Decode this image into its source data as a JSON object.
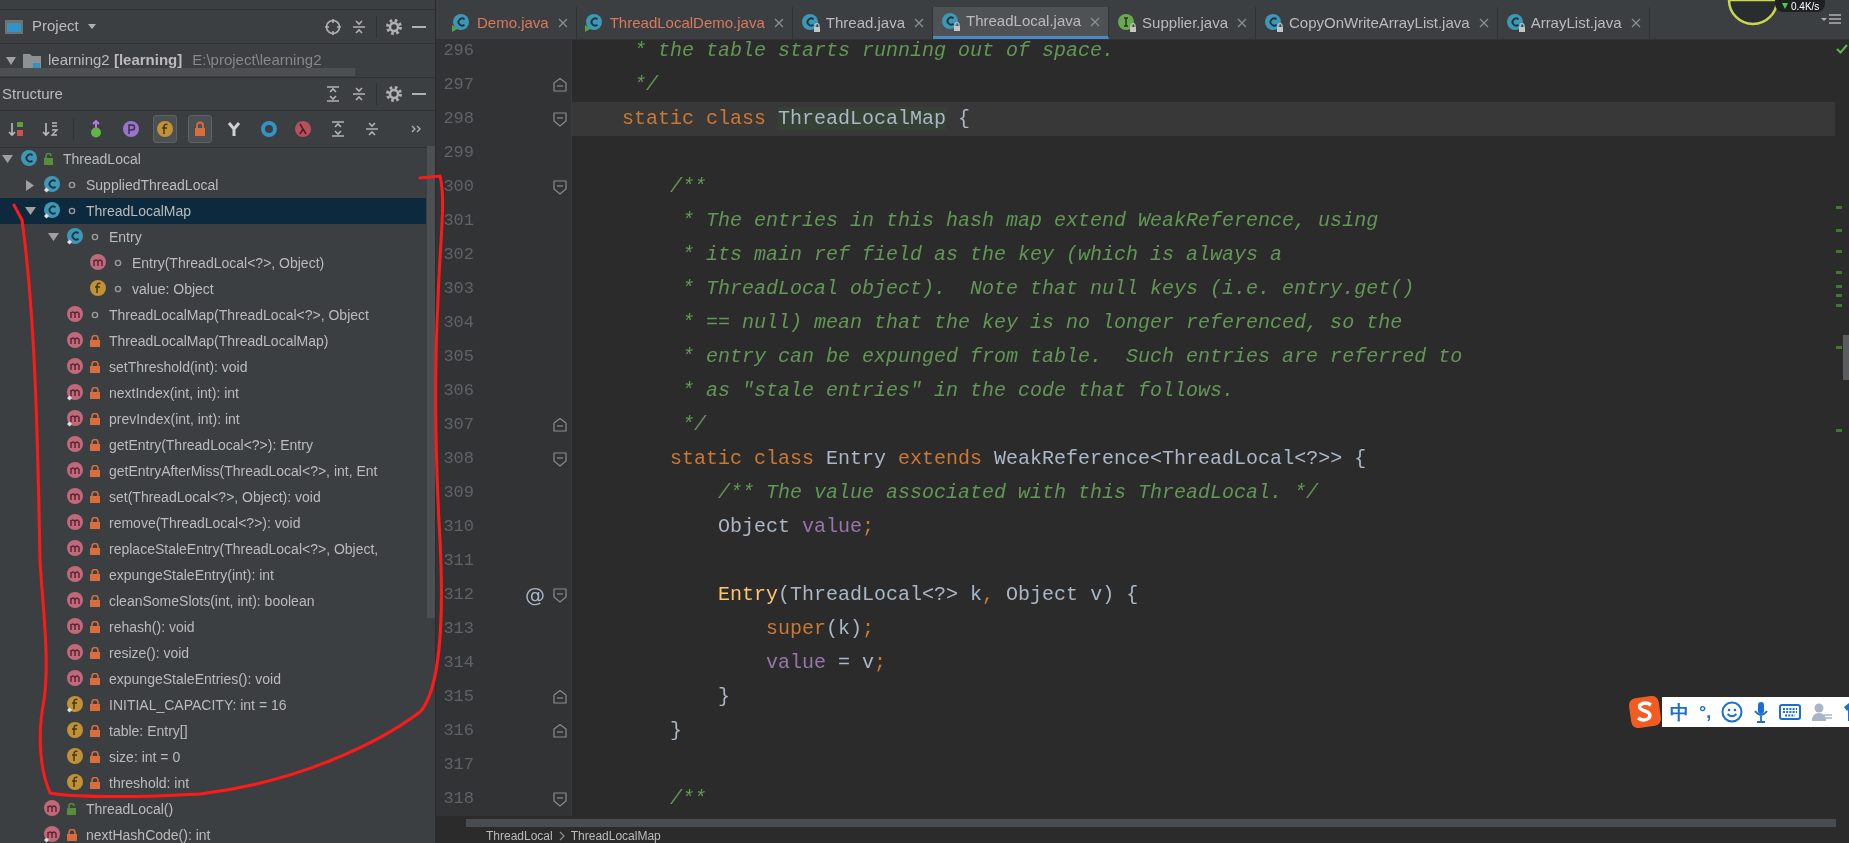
{
  "project_panel": {
    "title": "Project",
    "project_name": "learning2 **[learning]**",
    "project_path": "E:\\project\\learning2"
  },
  "structure_panel": {
    "title": "Structure",
    "toolbar": [
      {
        "kind": "sort-visibility",
        "on": false
      },
      {
        "kind": "sort-alpha",
        "on": false
      },
      {
        "kind": "inherited",
        "on": false
      },
      {
        "kind": "properties",
        "on": false
      },
      {
        "kind": "fields",
        "on": true
      },
      {
        "kind": "non-public",
        "on": true
      },
      {
        "kind": "hierarchy",
        "on": false
      },
      {
        "kind": "ring",
        "on": false
      },
      {
        "kind": "lambdas",
        "on": false
      },
      {
        "kind": "expand",
        "on": false
      },
      {
        "kind": "collapse",
        "on": false
      },
      {
        "kind": "more",
        "on": false
      }
    ],
    "tree": [
      {
        "label": "ThreadLocal",
        "kind": "class",
        "public": true,
        "private": false,
        "static": false,
        "expanded": true,
        "selected": false,
        "children": [
          {
            "label": "SuppliedThreadLocal",
            "kind": "class",
            "public": false,
            "private": false,
            "static": true,
            "expanded": false,
            "selected": false
          },
          {
            "label": "ThreadLocalMap",
            "kind": "class",
            "public": false,
            "private": false,
            "static": true,
            "expanded": true,
            "selected": true,
            "children": [
              {
                "label": "Entry",
                "kind": "class",
                "public": false,
                "private": false,
                "static": true,
                "expanded": true,
                "selected": false,
                "children": [
                  {
                    "label": "Entry(ThreadLocal<?>, Object)",
                    "kind": "method",
                    "public": false,
                    "private": false,
                    "static": false,
                    "selected": false
                  },
                  {
                    "label": "value: Object",
                    "kind": "field",
                    "public": false,
                    "private": false,
                    "static": false,
                    "selected": false
                  }
                ]
              },
              {
                "label": "ThreadLocalMap(ThreadLocal<?>, Object",
                "kind": "method",
                "public": false,
                "private": false,
                "static": false,
                "selected": false
              },
              {
                "label": "ThreadLocalMap(ThreadLocalMap)",
                "kind": "method",
                "public": false,
                "private": true,
                "static": false,
                "selected": false
              },
              {
                "label": "setThreshold(int): void",
                "kind": "method",
                "public": false,
                "private": true,
                "static": false,
                "selected": false
              },
              {
                "label": "nextIndex(int, int): int",
                "kind": "method",
                "public": false,
                "private": true,
                "static": true,
                "selected": false
              },
              {
                "label": "prevIndex(int, int): int",
                "kind": "method",
                "public": false,
                "private": true,
                "static": true,
                "selected": false
              },
              {
                "label": "getEntry(ThreadLocal<?>): Entry",
                "kind": "method",
                "public": false,
                "private": true,
                "static": false,
                "selected": false
              },
              {
                "label": "getEntryAfterMiss(ThreadLocal<?>, int, Ent",
                "kind": "method",
                "public": false,
                "private": true,
                "static": false,
                "selected": false
              },
              {
                "label": "set(ThreadLocal<?>, Object): void",
                "kind": "method",
                "public": false,
                "private": true,
                "static": false,
                "selected": false
              },
              {
                "label": "remove(ThreadLocal<?>): void",
                "kind": "method",
                "public": false,
                "private": true,
                "static": false,
                "selected": false
              },
              {
                "label": "replaceStaleEntry(ThreadLocal<?>, Object,",
                "kind": "method",
                "public": false,
                "private": true,
                "static": false,
                "selected": false
              },
              {
                "label": "expungeStaleEntry(int): int",
                "kind": "method",
                "public": false,
                "private": true,
                "static": false,
                "selected": false
              },
              {
                "label": "cleanSomeSlots(int, int): boolean",
                "kind": "method",
                "public": false,
                "private": true,
                "static": false,
                "selected": false
              },
              {
                "label": "rehash(): void",
                "kind": "method",
                "public": false,
                "private": true,
                "static": false,
                "selected": false
              },
              {
                "label": "resize(): void",
                "kind": "method",
                "public": false,
                "private": true,
                "static": false,
                "selected": false
              },
              {
                "label": "expungeStaleEntries(): void",
                "kind": "method",
                "public": false,
                "private": true,
                "static": false,
                "selected": false
              },
              {
                "label": "INITIAL_CAPACITY: int = 16",
                "kind": "field",
                "public": false,
                "private": true,
                "static": true,
                "selected": false
              },
              {
                "label": "table: Entry[]",
                "kind": "field",
                "public": false,
                "private": true,
                "static": false,
                "selected": false
              },
              {
                "label": "size: int = 0",
                "kind": "field",
                "public": false,
                "private": true,
                "static": false,
                "selected": false
              },
              {
                "label": "threshold: int",
                "kind": "field",
                "public": false,
                "private": true,
                "static": false,
                "selected": false
              }
            ]
          },
          {
            "label": "ThreadLocal()",
            "kind": "method",
            "public": true,
            "private": false,
            "static": false,
            "selected": false
          },
          {
            "label": "nextHashCode(): int",
            "kind": "method",
            "public": false,
            "private": true,
            "static": true,
            "selected": false
          }
        ]
      }
    ]
  },
  "tabs": [
    {
      "label": "Demo.java",
      "kind": "class",
      "runnable": true,
      "read_only": false,
      "color": "#d8795e",
      "selected": false
    },
    {
      "label": "ThreadLocalDemo.java",
      "kind": "class",
      "runnable": true,
      "read_only": false,
      "color": "#d8795e",
      "selected": false
    },
    {
      "label": "Thread.java",
      "kind": "class",
      "runnable": false,
      "read_only": true,
      "color": "#bbbbbb",
      "selected": false
    },
    {
      "label": "ThreadLocal.java",
      "kind": "class",
      "runnable": false,
      "read_only": true,
      "color": "#bbbbbb",
      "selected": true
    },
    {
      "label": "Supplier.java",
      "kind": "interface",
      "runnable": false,
      "read_only": true,
      "color": "#bbbbbb",
      "selected": false
    },
    {
      "label": "CopyOnWriteArrayList.java",
      "kind": "class",
      "runnable": false,
      "read_only": true,
      "color": "#bbbbbb",
      "selected": false
    },
    {
      "label": "ArrayList.java",
      "kind": "class",
      "runnable": false,
      "read_only": true,
      "color": "#bbbbbb",
      "selected": false
    }
  ],
  "editor": {
    "lines": [
      {
        "number": "296",
        "kind": "plain",
        "current": false,
        "tokens": [
          {
            "text": "     * the table starts running out of space.",
            "kind": "comment"
          }
        ]
      },
      {
        "number": "297",
        "kind": "fold-end",
        "current": false,
        "tokens": [
          {
            "text": "     */",
            "kind": "comment"
          }
        ]
      },
      {
        "number": "298",
        "kind": "fold-start",
        "current": true,
        "tokens": [
          {
            "text": "    static class ",
            "kind": "keyword"
          },
          {
            "text": "ThreadLocalMap",
            "kind": "highlight"
          },
          {
            "text": " {",
            "kind": "plain"
          }
        ]
      },
      {
        "number": "299",
        "kind": "plain",
        "current": false
      },
      {
        "number": "300",
        "kind": "fold-start",
        "current": false,
        "tokens": [
          {
            "text": "        /**",
            "kind": "comment"
          }
        ]
      },
      {
        "number": "301",
        "kind": "plain",
        "current": false,
        "tokens": [
          {
            "text": "         * The entries in this hash map extend WeakReference, using",
            "kind": "comment"
          }
        ]
      },
      {
        "number": "302",
        "kind": "plain",
        "current": false,
        "tokens": [
          {
            "text": "         * its main ref field as the key (which is always a",
            "kind": "comment"
          }
        ]
      },
      {
        "number": "303",
        "kind": "plain",
        "current": false,
        "tokens": [
          {
            "text": "         * ThreadLocal object).  Note that null keys (i.e. entry.get()",
            "kind": "comment"
          }
        ]
      },
      {
        "number": "304",
        "kind": "plain",
        "current": false,
        "tokens": [
          {
            "text": "         * == null) mean that the key is no longer referenced, so the",
            "kind": "comment"
          }
        ]
      },
      {
        "number": "305",
        "kind": "plain",
        "current": false,
        "tokens": [
          {
            "text": "         * entry can be expunged from table.  Such entries are referred to",
            "kind": "comment"
          }
        ]
      },
      {
        "number": "306",
        "kind": "plain",
        "current": false,
        "tokens": [
          {
            "text": "         * as \"stale entries\" in the code that follows.",
            "kind": "comment"
          }
        ]
      },
      {
        "number": "307",
        "kind": "fold-end",
        "current": false,
        "tokens": [
          {
            "text": "         */",
            "kind": "comment"
          }
        ]
      },
      {
        "number": "308",
        "kind": "fold-start",
        "current": false,
        "tokens": [
          {
            "text": "        static class ",
            "kind": "keyword"
          },
          {
            "text": "Entry ",
            "kind": "plain"
          },
          {
            "text": "extends ",
            "kind": "keyword"
          },
          {
            "text": "WeakReference<ThreadLocal<?>> {",
            "kind": "plain"
          }
        ]
      },
      {
        "number": "309",
        "kind": "plain",
        "current": false,
        "tokens": [
          {
            "text": "            /** The value associated with this ThreadLocal. */",
            "kind": "comment"
          }
        ]
      },
      {
        "number": "310",
        "kind": "plain",
        "current": false,
        "tokens": [
          {
            "text": "            Object ",
            "kind": "plain"
          },
          {
            "text": "value",
            "kind": "field"
          },
          {
            "text": ";",
            "kind": "keyword"
          }
        ]
      },
      {
        "number": "311",
        "kind": "plain",
        "current": false
      },
      {
        "number": "312",
        "kind": "fold-start",
        "current": false,
        "gutter_mark": "@",
        "tokens": [
          {
            "text": "            Entry",
            "kind": "method"
          },
          {
            "text": "(ThreadLocal<?> k",
            "kind": "plain"
          },
          {
            "text": ",",
            "kind": "keyword"
          },
          {
            "text": " Object v) {",
            "kind": "plain"
          }
        ]
      },
      {
        "number": "313",
        "kind": "plain",
        "current": false,
        "tokens": [
          {
            "text": "                super",
            "kind": "keyword"
          },
          {
            "text": "(k)",
            "kind": "plain"
          },
          {
            "text": ";",
            "kind": "keyword"
          }
        ]
      },
      {
        "number": "314",
        "kind": "plain",
        "current": false,
        "tokens": [
          {
            "text": "                value",
            "kind": "field"
          },
          {
            "text": " = v",
            "kind": "plain"
          },
          {
            "text": ";",
            "kind": "keyword"
          }
        ]
      },
      {
        "number": "315",
        "kind": "fold-end",
        "current": false,
        "tokens": [
          {
            "text": "            }",
            "kind": "plain"
          }
        ]
      },
      {
        "number": "316",
        "kind": "fold-end",
        "current": false,
        "tokens": [
          {
            "text": "        }",
            "kind": "plain"
          }
        ]
      },
      {
        "number": "317",
        "kind": "plain",
        "current": false
      },
      {
        "number": "318",
        "kind": "fold-start",
        "current": false,
        "tokens": [
          {
            "text": "        /**",
            "kind": "comment"
          }
        ]
      }
    ]
  },
  "breadcrumb": [
    "ThreadLocal",
    "ThreadLocalMap"
  ],
  "network_meter": {
    "reading": "0.4K/s"
  },
  "ime_toolbar": {
    "mode": "中",
    "punctuation": "°,"
  }
}
